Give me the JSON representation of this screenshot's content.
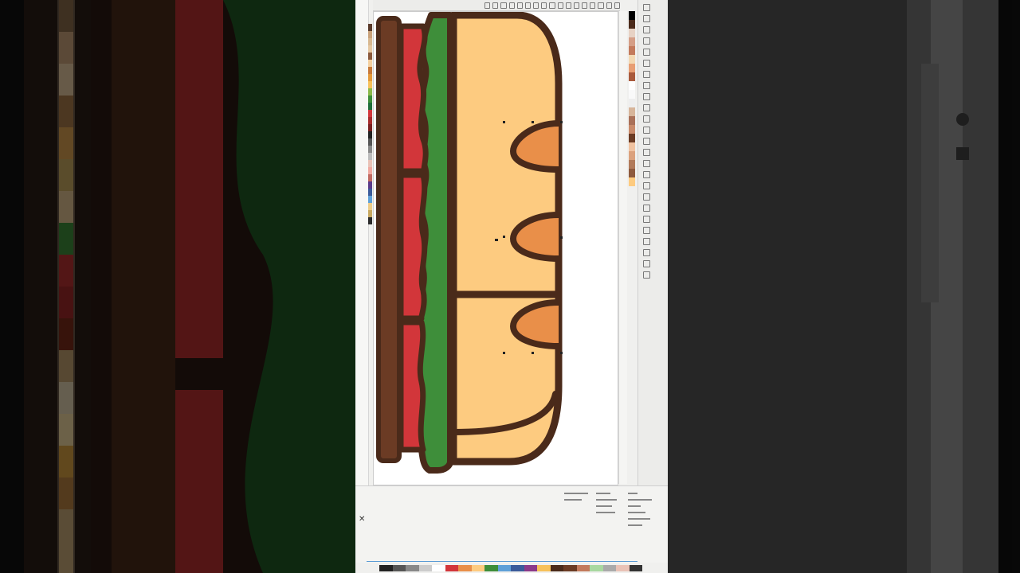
{
  "app": {
    "name": "vector-editor"
  },
  "colors": {
    "bread": "#FDCB80",
    "outline": "#4A2A1A",
    "lettuce": "#3E8E3A",
    "tomato": "#D2363A",
    "crust": "#6B3B24",
    "score": "#E98F49",
    "canvas": "#FFFFFF",
    "background_blur": "#3a2a22"
  },
  "palette_left": [
    "#5a3a2a",
    "#c9a27a",
    "#d8b890",
    "#e5c7a1",
    "#8b5a3c",
    "#f4d0a0",
    "#c87a3a",
    "#e59a3a",
    "#f7c15a",
    "#8bb94a",
    "#3e8e3a",
    "#1f6e3a",
    "#d2363a",
    "#a82b2b",
    "#7a1f1f",
    "#222",
    "#555",
    "#888",
    "#bbb",
    "#e9c2b6",
    "#f0a9a0",
    "#c16b62",
    "#5b3b8a",
    "#3b5b9a",
    "#5fa0d8",
    "#eecc88",
    "#c8a860",
    "#2b2b2b"
  ],
  "swatches_right": [
    "#000",
    "#4a2a1a",
    "#e7d2c4",
    "#d59e86",
    "#c37a5c",
    "#f3d8b2",
    "#e89e74",
    "#a95a3c",
    "#fff",
    "#f9f9f9",
    "#eee",
    "#d7b59a",
    "#a97058",
    "#c98a6a",
    "#6b3b24",
    "#f0c2a0",
    "#dba17d",
    "#b17a5a",
    "#8e5a3e",
    "#fdcb80"
  ],
  "palette_bottom": [
    "#222",
    "#555",
    "#888",
    "#ccc",
    "#fff",
    "#d2363a",
    "#e98f49",
    "#fdcb80",
    "#3e8e3a",
    "#5fa0d8",
    "#3b5b9a",
    "#8b3a8a",
    "#f7c15a",
    "#4a2a1a",
    "#6b3b24",
    "#c37a5c",
    "#a8d8a0",
    "#aaa",
    "#e9c2b6",
    "#333"
  ]
}
